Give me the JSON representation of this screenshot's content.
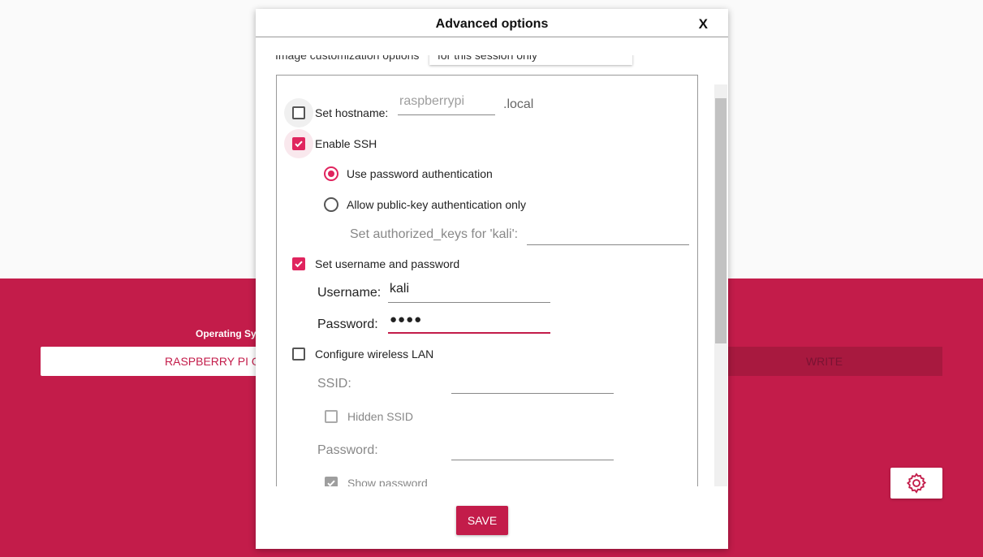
{
  "app": {
    "os_label": "Operating Sys",
    "os_button": "RASPBERRY PI OS",
    "write_button": "WRITE",
    "settings_icon": "gear-icon",
    "accent": "#c31c4a"
  },
  "dialog": {
    "title": "Advanced options",
    "close": "X",
    "partial_label": "Image customization options",
    "partial_value": "for this session only",
    "hostname": {
      "label": "Set hostname:",
      "checked": false,
      "placeholder": "raspberrypi",
      "suffix": ".local"
    },
    "ssh": {
      "label": "Enable SSH",
      "checked": true,
      "password_auth": "Use password authentication",
      "pubkey_auth": "Allow public-key authentication only",
      "authorized_keys_label": "Set authorized_keys for 'kali':"
    },
    "user": {
      "label": "Set username and password",
      "checked": true,
      "username_label": "Username:",
      "username_value": "kali",
      "password_label": "Password:",
      "password_value": "●●●●"
    },
    "wifi": {
      "label": "Configure wireless LAN",
      "checked": false,
      "ssid_label": "SSID:",
      "hidden_ssid": "Hidden SSID",
      "password_label": "Password:",
      "show_password": "Show password"
    },
    "save": "SAVE"
  }
}
